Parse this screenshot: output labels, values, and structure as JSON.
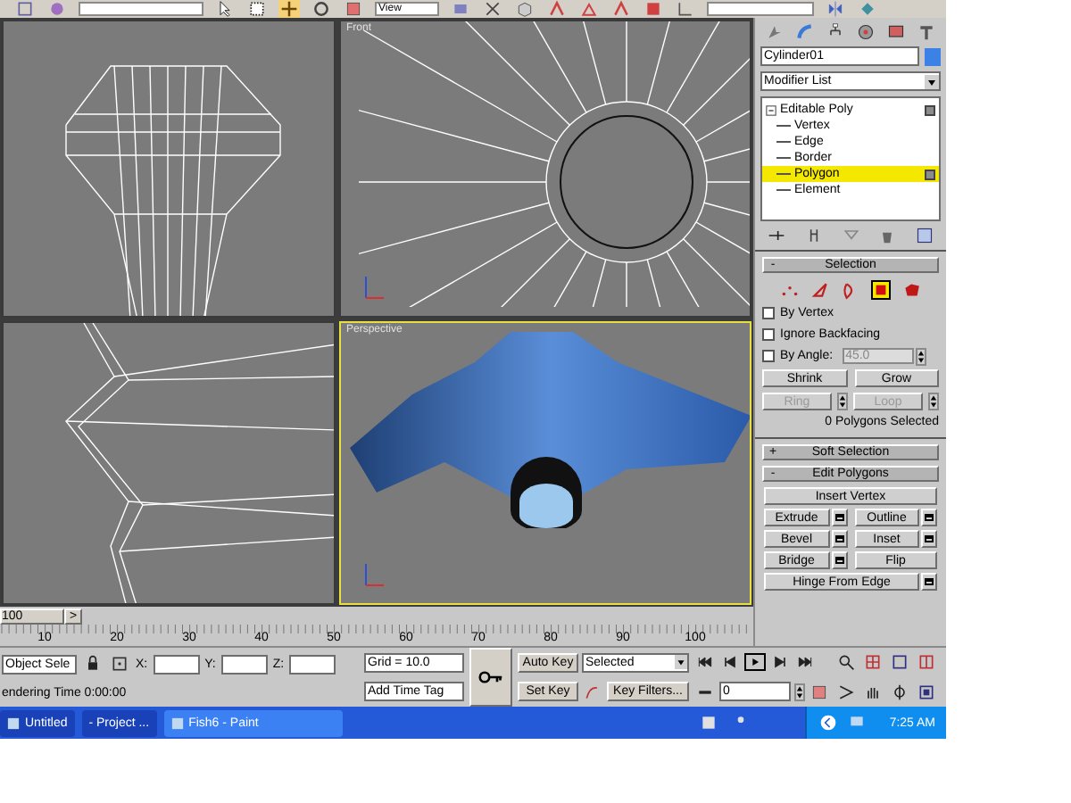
{
  "toolbar": {
    "view_dropdown": "View"
  },
  "viewports": [
    {
      "kind": "top",
      "selected": false
    },
    {
      "kind": "front",
      "label": "Front",
      "selected": false
    },
    {
      "kind": "left",
      "selected": false
    },
    {
      "kind": "shaded",
      "label": "Perspective",
      "selected": true
    }
  ],
  "command_panel": {
    "object_name": "Cylinder01",
    "modifier_list": "Modifier List",
    "stack": {
      "label": "Editable Poly",
      "children": [
        {
          "label": "Vertex",
          "selected": false
        },
        {
          "label": "Edge",
          "selected": false
        },
        {
          "label": "Border",
          "selected": false
        },
        {
          "label": "Polygon",
          "selected": true
        },
        {
          "label": "Element",
          "selected": false
        }
      ]
    },
    "selection": {
      "sign": "-",
      "title": "Selection",
      "levels": [
        {
          "selected": false
        },
        {
          "selected": false
        },
        {
          "selected": false
        },
        {
          "selected": true
        },
        {
          "selected": false
        }
      ],
      "checkboxes": [
        {
          "label": "By Vertex",
          "checked": false
        },
        {
          "label": "Ignore Backfacing",
          "checked": false
        },
        {
          "label": "By Angle:",
          "checked": false
        }
      ],
      "angle": "45.0",
      "buttons": [
        {
          "label": "Shrink",
          "disabled": false
        },
        {
          "label": "Grow",
          "disabled": false
        },
        {
          "label": "Ring",
          "disabled": true
        },
        {
          "label": "Loop",
          "disabled": true
        }
      ],
      "status": "0 Polygons Selected"
    },
    "soft_selection": {
      "sign": "+",
      "title": "Soft Selection"
    },
    "edit_polygons": {
      "sign": "-",
      "title": "Edit Polygons",
      "wide_button": "Insert Vertex",
      "buttons": [
        {
          "label": "Extrude",
          "settings": true
        },
        {
          "label": "Outline",
          "settings": true
        },
        {
          "label": "Bevel",
          "settings": true
        },
        {
          "label": "Inset",
          "settings": true
        },
        {
          "label": "Bridge",
          "settings": true
        },
        {
          "label": "Flip",
          "settings": false
        },
        {
          "label": "Hinge From Edge",
          "settings": true
        }
      ]
    }
  },
  "timeline": {
    "frame": "100",
    "next": ">",
    "ticks": [
      "10",
      "20",
      "30",
      "40",
      "50",
      "60",
      "70",
      "80",
      "90",
      "100"
    ]
  },
  "status_bar": {
    "selection": "Object Sele",
    "x": "X:",
    "y": "Y:",
    "z": "Z:",
    "grid": "Grid = 10.0",
    "prompt": "endering Time  0:00:00",
    "time_tag": "Add Time Tag",
    "auto_key": "Auto Key",
    "key_mode": "Selected",
    "set_key": "Set Key",
    "key_filters": "Key Filters...",
    "current_frame": "0"
  },
  "taskbar": {
    "items": [
      {
        "label": "Untitled",
        "selected": false
      },
      {
        "label": "- Project ...",
        "selected": false
      },
      {
        "label": "Fish6 - Paint",
        "selected": true
      }
    ],
    "clock": "7:25 AM"
  }
}
